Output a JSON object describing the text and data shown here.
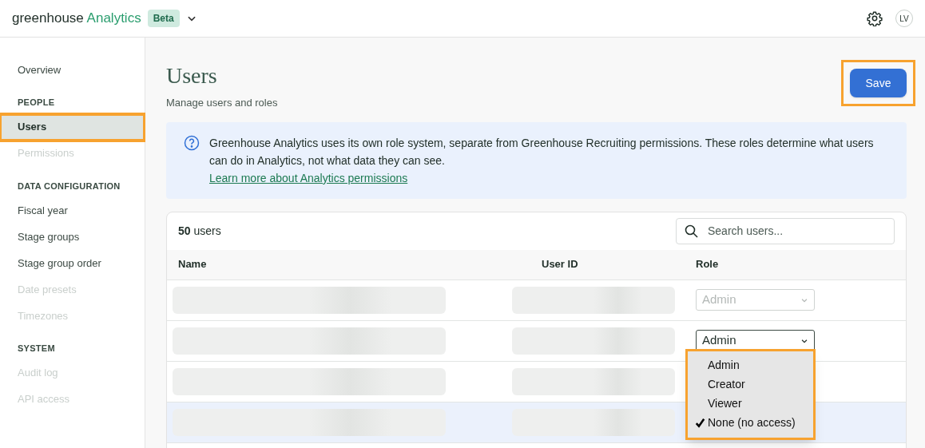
{
  "header": {
    "brand_prefix": "greenhouse",
    "brand_product": "Analytics",
    "badge": "Beta",
    "avatar": "LV"
  },
  "sidebar": {
    "sections": [
      {
        "items": [
          {
            "label": "Overview",
            "selected": false,
            "disabled": false,
            "highlighted": false
          }
        ]
      },
      {
        "heading": "PEOPLE",
        "items": [
          {
            "label": "Users",
            "selected": true,
            "disabled": false,
            "highlighted": true
          },
          {
            "label": "Permissions",
            "selected": false,
            "disabled": true,
            "highlighted": false
          }
        ]
      },
      {
        "heading": "DATA CONFIGURATION",
        "items": [
          {
            "label": "Fiscal year",
            "selected": false,
            "disabled": false,
            "highlighted": false
          },
          {
            "label": "Stage groups",
            "selected": false,
            "disabled": false,
            "highlighted": false
          },
          {
            "label": "Stage group order",
            "selected": false,
            "disabled": false,
            "highlighted": false
          },
          {
            "label": "Date presets",
            "selected": false,
            "disabled": true,
            "highlighted": false
          },
          {
            "label": "Timezones",
            "selected": false,
            "disabled": true,
            "highlighted": false
          }
        ]
      },
      {
        "heading": "SYSTEM",
        "items": [
          {
            "label": "Audit log",
            "selected": false,
            "disabled": true,
            "highlighted": false
          },
          {
            "label": "API access",
            "selected": false,
            "disabled": true,
            "highlighted": false
          }
        ]
      }
    ]
  },
  "page": {
    "title": "Users",
    "subtitle": "Manage users and roles",
    "save_button": {
      "label": "Save",
      "highlighted": true
    }
  },
  "info": {
    "text": "Greenhouse Analytics uses its own role system, separate from Greenhouse Recruiting permissions. These roles determine what users can do in Analytics, not what data they can see.",
    "link": "Learn more about Analytics permissions"
  },
  "table": {
    "count": "**50** users",
    "search": {
      "placeholder": "Search users..."
    },
    "columns": [
      "Name",
      "User ID",
      "Role"
    ],
    "rows": [
      {
        "selected": false,
        "role": {
          "value": "Admin",
          "disabled": true,
          "open": false
        }
      },
      {
        "selected": false,
        "role": {
          "value": "Admin",
          "disabled": false,
          "open": true
        }
      },
      {
        "selected": false
      },
      {
        "selected": true
      },
      {
        "selected": false
      }
    ]
  },
  "role_menu": {
    "highlighted": true,
    "options": [
      {
        "label": "Admin",
        "selected": false
      },
      {
        "label": "Creator",
        "selected": false
      },
      {
        "label": "Viewer",
        "selected": false
      },
      {
        "label": "None (no access)",
        "selected": true
      }
    ]
  }
}
